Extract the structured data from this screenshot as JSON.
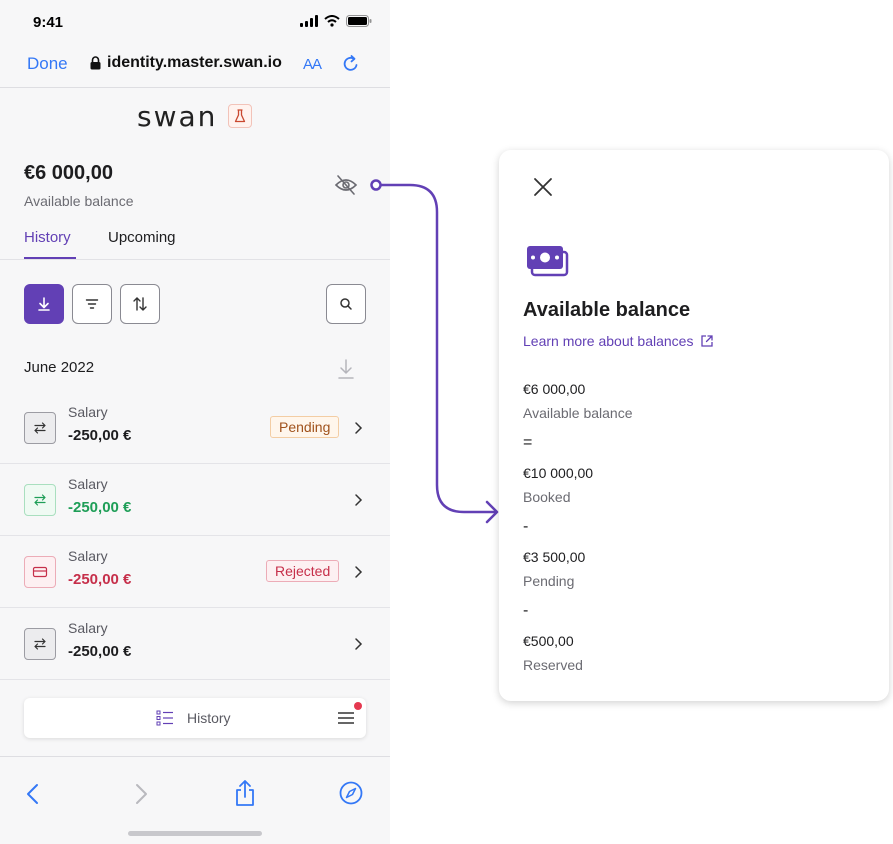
{
  "status_bar": {
    "time": "9:41"
  },
  "browser": {
    "done_label": "Done",
    "host": "identity.master.swan.io",
    "text_size_label": "AA"
  },
  "app": {
    "logo": "swan",
    "balance": {
      "amount": "€6 000,00",
      "label": "Available balance"
    },
    "tabs": [
      {
        "label": "History"
      },
      {
        "label": "Upcoming"
      }
    ],
    "month": {
      "title": "June 2022"
    },
    "transactions": [
      {
        "label": "Salary",
        "amount": "-250,00 €",
        "status": "Pending"
      },
      {
        "label": "Salary",
        "amount": "-250,00 €",
        "status": ""
      },
      {
        "label": "Salary",
        "amount": "-250,00 €",
        "status": "Rejected"
      },
      {
        "label": "Salary",
        "amount": "-250,00 €",
        "status": ""
      }
    ],
    "bottom_nav": {
      "label": "History"
    }
  },
  "card": {
    "title": "Available balance",
    "link": "Learn more about balances",
    "breakdown": [
      {
        "value": "€6 000,00",
        "label": "Available balance"
      },
      {
        "op": "="
      },
      {
        "value": "€10 000,00",
        "label": "Booked"
      },
      {
        "op": "-"
      },
      {
        "value": "€3 500,00",
        "label": "Pending"
      },
      {
        "op": "-"
      },
      {
        "value": "€500,00",
        "label": "Reserved"
      }
    ]
  },
  "colors": {
    "accent": "#6240b5",
    "browser_blue": "#3478f6",
    "positive": "#1e9e57",
    "negative": "#c62f4a",
    "pending": "#a0521c"
  },
  "icons": {
    "lock": "lock-icon",
    "reload": "reload-icon",
    "eye_off": "eye-off-icon",
    "download": "download-icon",
    "filter": "filter-icon",
    "sort": "sort-icon",
    "search": "search-icon",
    "transfer": "transfer-icon",
    "card": "card-icon",
    "chevron": "chevron-right-icon",
    "list": "list-icon",
    "menu": "menu-icon",
    "close": "close-icon",
    "cash": "cash-icon",
    "external": "external-link-icon"
  }
}
